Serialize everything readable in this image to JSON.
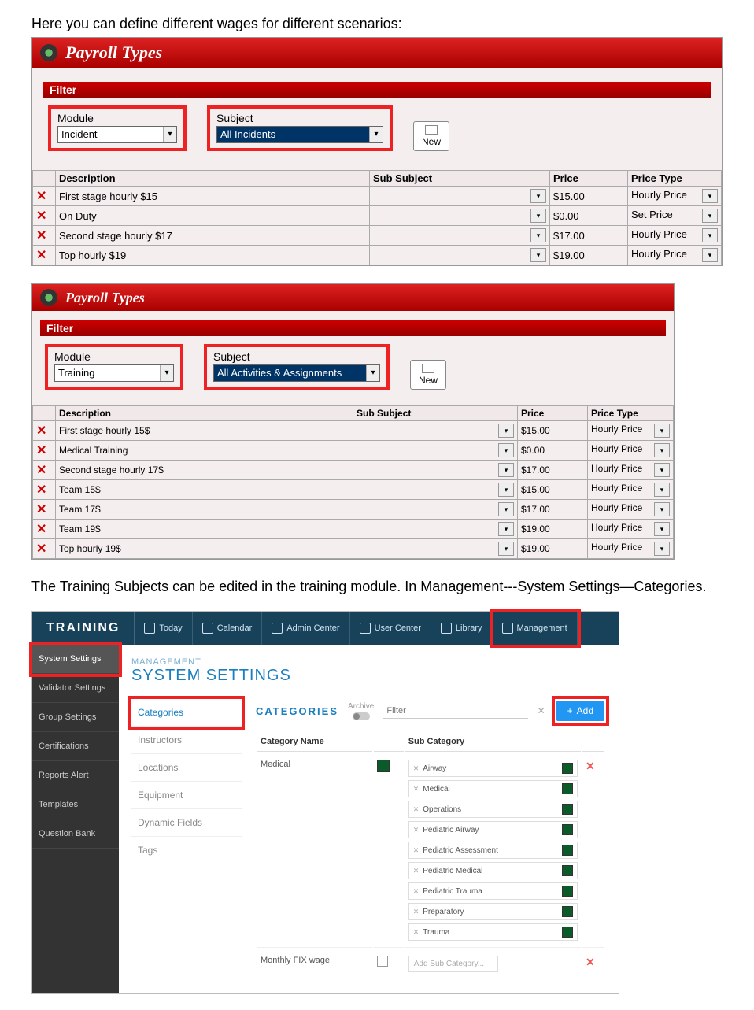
{
  "intro_text": "Here you can define different wages for different scenarios:",
  "middle_text": "The Training Subjects can be edited in the training module. In Management---System Settings—Categories.",
  "payroll1": {
    "title": "Payroll Types",
    "filter_label": "Filter",
    "module_label": "Module",
    "module_value": "Incident",
    "subject_label": "Subject",
    "subject_value": "All Incidents",
    "new_label": "New",
    "columns": {
      "desc": "Description",
      "sub": "Sub Subject",
      "price": "Price",
      "ptype": "Price Type"
    },
    "rows": [
      {
        "desc": "First stage hourly $15",
        "sub": "",
        "price": "$15.00",
        "ptype": "Hourly Price"
      },
      {
        "desc": "On Duty",
        "sub": "",
        "price": "$0.00",
        "ptype": "Set Price"
      },
      {
        "desc": "Second stage hourly $17",
        "sub": "",
        "price": "$17.00",
        "ptype": "Hourly Price"
      },
      {
        "desc": "Top hourly $19",
        "sub": "",
        "price": "$19.00",
        "ptype": "Hourly Price"
      }
    ]
  },
  "payroll2": {
    "title": "Payroll Types",
    "filter_label": "Filter",
    "module_label": "Module",
    "module_value": "Training",
    "subject_label": "Subject",
    "subject_value": "All Activities & Assignments",
    "new_label": "New",
    "columns": {
      "desc": "Description",
      "sub": "Sub Subject",
      "price": "Price",
      "ptype": "Price Type"
    },
    "rows": [
      {
        "desc": "First stage hourly 15$",
        "sub": "",
        "price": "$15.00",
        "ptype": "Hourly Price"
      },
      {
        "desc": "Medical Training",
        "sub": "",
        "price": "$0.00",
        "ptype": "Hourly Price"
      },
      {
        "desc": "Second stage hourly 17$",
        "sub": "",
        "price": "$17.00",
        "ptype": "Hourly Price"
      },
      {
        "desc": "Team 15$",
        "sub": "",
        "price": "$15.00",
        "ptype": "Hourly Price"
      },
      {
        "desc": "Team 17$",
        "sub": "",
        "price": "$17.00",
        "ptype": "Hourly Price"
      },
      {
        "desc": "Team 19$",
        "sub": "",
        "price": "$19.00",
        "ptype": "Hourly Price"
      },
      {
        "desc": "Top hourly 19$",
        "sub": "",
        "price": "$19.00",
        "ptype": "Hourly Price"
      }
    ]
  },
  "training": {
    "brand": "TRAINING",
    "nav": [
      {
        "label": "Today"
      },
      {
        "label": "Calendar"
      },
      {
        "label": "Admin Center"
      },
      {
        "label": "User Center"
      },
      {
        "label": "Library"
      },
      {
        "label": "Management"
      }
    ],
    "sidebar": [
      "System Settings",
      "Validator Settings",
      "Group Settings",
      "Certifications",
      "Reports Alert",
      "Templates",
      "Question Bank"
    ],
    "breadcrumb": "MANAGEMENT",
    "page_title": "SYSTEM SETTINGS",
    "subnav": [
      "Categories",
      "Instructors",
      "Locations",
      "Equipment",
      "Dynamic Fields",
      "Tags"
    ],
    "categories_title": "CATEGORIES",
    "archive_label": "Archive",
    "filter_placeholder": "Filter",
    "add_label": "Add",
    "table_headers": {
      "name": "Category Name",
      "sub": "Sub Category"
    },
    "cat_rows": [
      {
        "name": "Medical",
        "subs": [
          "Airway",
          "Medical",
          "Operations",
          "Pediatric Airway",
          "Pediatric Assessment",
          "Pediatric Medical",
          "Pediatric Trauma",
          "Preparatory",
          "Trauma"
        ]
      },
      {
        "name": "Monthly FIX wage",
        "subs": [],
        "add_placeholder": "Add Sub Category..."
      }
    ]
  }
}
